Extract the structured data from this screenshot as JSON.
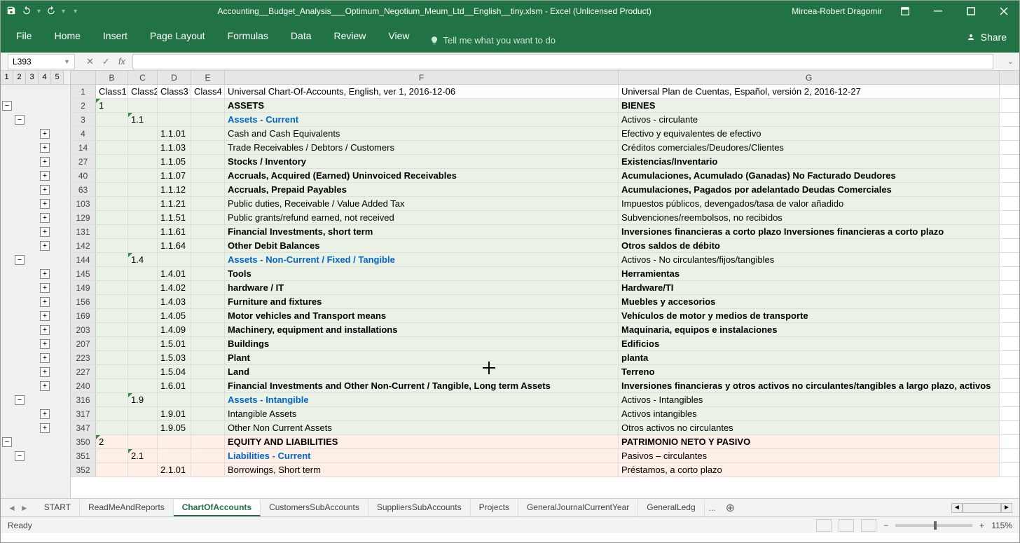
{
  "titlebar": {
    "title": "Accounting__Budget_Analysis___Optimum_Negotium_Meum_Ltd__English__tiny.xlsm  -  Excel (Unlicensed Product)",
    "username": "Mircea-Robert Dragomir"
  },
  "ribbon": {
    "tabs": [
      "File",
      "Home",
      "Insert",
      "Page Layout",
      "Formulas",
      "Data",
      "Review",
      "View"
    ],
    "tellme": "Tell me what you want to do",
    "share": "Share"
  },
  "namebox": "L393",
  "outline_levels": [
    "1",
    "2",
    "3",
    "4",
    "5"
  ],
  "columns": {
    "b": "B",
    "c": "C",
    "d": "D",
    "e": "E",
    "f": "F",
    "g": "G"
  },
  "header_row": {
    "num": "1",
    "b": "Class1",
    "c": "Class2",
    "d": "Class3",
    "e": "Class4",
    "f": "Universal Chart-Of-Accounts, English, ver 1, 2016-12-06",
    "g": "Universal Plan de Cuentas, Español, versión 2, 2016-12-27"
  },
  "rows": [
    {
      "num": "2",
      "b": "1",
      "c": "",
      "d": "",
      "e": "",
      "f": "ASSETS",
      "g": "BIENES",
      "bold": true,
      "bg": "green",
      "tri": "b"
    },
    {
      "num": "3",
      "b": "",
      "c": "1.1",
      "d": "",
      "e": "",
      "f": "Assets - Current",
      "g": "Activos - circulante",
      "blue": true,
      "bg": "green",
      "tri": "c"
    },
    {
      "num": "4",
      "b": "",
      "c": "",
      "d": "1.1.01",
      "e": "",
      "f": "Cash and Cash Equivalents",
      "g": "Efectivo y equivalentes de efectivo",
      "bg": "green"
    },
    {
      "num": "14",
      "b": "",
      "c": "",
      "d": "1.1.03",
      "e": "",
      "f": "Trade Receivables / Debtors / Customers",
      "g": "Créditos comerciales/Deudores/Clientes",
      "bg": "green"
    },
    {
      "num": "27",
      "b": "",
      "c": "",
      "d": "1.1.05",
      "e": "",
      "f": "Stocks / Inventory",
      "g": "Existencias/Inventario",
      "bold": true,
      "bg": "green"
    },
    {
      "num": "40",
      "b": "",
      "c": "",
      "d": "1.1.07",
      "e": "",
      "f": "Accruals, Acquired (Earned) Uninvoiced Receivables",
      "g": "Acumulaciones, Acumulado (Ganadas) No Facturado Deudores",
      "bold": true,
      "bg": "green"
    },
    {
      "num": "63",
      "b": "",
      "c": "",
      "d": "1.1.12",
      "e": "",
      "f": "Accruals, Prepaid Payables",
      "g": "Acumulaciones, Pagados por adelantado Deudas Comerciales",
      "bold": true,
      "bg": "green"
    },
    {
      "num": "103",
      "b": "",
      "c": "",
      "d": "1.1.21",
      "e": "",
      "f": "Public duties, Receivable / Value Added Tax",
      "g": "Impuestos públicos, devengados/tasa de valor añadido",
      "bg": "green"
    },
    {
      "num": "129",
      "b": "",
      "c": "",
      "d": "1.1.51",
      "e": "",
      "f": "Public grants/refund earned, not received",
      "g": "Subvenciones/reembolsos, no recibidos",
      "bg": "green"
    },
    {
      "num": "131",
      "b": "",
      "c": "",
      "d": "1.1.61",
      "e": "",
      "f": "Financial Investments, short term",
      "g": "Inversiones financieras a corto plazo Inversiones financieras a corto plazo",
      "bold": true,
      "bg": "green"
    },
    {
      "num": "142",
      "b": "",
      "c": "",
      "d": "1.1.64",
      "e": "",
      "f": "Other Debit Balances",
      "g": "Otros saldos de débito",
      "bold": true,
      "bg": "green"
    },
    {
      "num": "144",
      "b": "",
      "c": "1.4",
      "d": "",
      "e": "",
      "f": "Assets - Non-Current / Fixed / Tangible",
      "g": "Activos - No circulantes/fijos/tangibles",
      "blue": true,
      "bg": "green",
      "tri": "c"
    },
    {
      "num": "145",
      "b": "",
      "c": "",
      "d": "1.4.01",
      "e": "",
      "f": "Tools",
      "g": "Herramientas",
      "bold": true,
      "bg": "green"
    },
    {
      "num": "149",
      "b": "",
      "c": "",
      "d": "1.4.02",
      "e": "",
      "f": "hardware / IT",
      "g": "Hardware/TI",
      "bold": true,
      "bg": "green"
    },
    {
      "num": "156",
      "b": "",
      "c": "",
      "d": "1.4.03",
      "e": "",
      "f": "Furniture and fixtures",
      "g": "Muebles y accesorios",
      "bold": true,
      "bg": "green"
    },
    {
      "num": "169",
      "b": "",
      "c": "",
      "d": "1.4.05",
      "e": "",
      "f": "Motor vehicles and Transport means",
      "g": "Vehículos de motor y medios de transporte",
      "bold": true,
      "bg": "green"
    },
    {
      "num": "203",
      "b": "",
      "c": "",
      "d": "1.4.09",
      "e": "",
      "f": "Machinery, equipment and installations",
      "g": "Maquinaria, equipos e instalaciones",
      "bold": true,
      "bg": "green"
    },
    {
      "num": "207",
      "b": "",
      "c": "",
      "d": "1.5.01",
      "e": "",
      "f": "Buildings",
      "g": "Edificios",
      "bold": true,
      "bg": "green"
    },
    {
      "num": "223",
      "b": "",
      "c": "",
      "d": "1.5.03",
      "e": "",
      "f": "Plant",
      "g": "planta",
      "bold": true,
      "bg": "green"
    },
    {
      "num": "227",
      "b": "",
      "c": "",
      "d": "1.5.04",
      "e": "",
      "f": "Land",
      "g": "Terreno",
      "bold": true,
      "bg": "green"
    },
    {
      "num": "240",
      "b": "",
      "c": "",
      "d": "1.6.01",
      "e": "",
      "f": "Financial Investments and Other Non-Current / Tangible, Long term Assets",
      "g": "Inversiones financieras y otros activos no circulantes/tangibles a largo plazo, activos",
      "bold": true,
      "bg": "green"
    },
    {
      "num": "316",
      "b": "",
      "c": "1.9",
      "d": "",
      "e": "",
      "f": "Assets - Intangible",
      "g": "Activos - Intangibles",
      "blue": true,
      "bg": "green",
      "tri": "c"
    },
    {
      "num": "317",
      "b": "",
      "c": "",
      "d": "1.9.01",
      "e": "",
      "f": "Intangible Assets",
      "g": "Activos intangibles",
      "bg": "green"
    },
    {
      "num": "347",
      "b": "",
      "c": "",
      "d": "1.9.05",
      "e": "",
      "f": "Other Non Current Assets",
      "g": "Otros activos no circulantes",
      "bg": "green"
    },
    {
      "num": "350",
      "b": "2",
      "c": "",
      "d": "",
      "e": "",
      "f": "EQUITY AND LIABILITIES",
      "g": "PATRIMONIO NETO Y PASIVO",
      "bold": true,
      "bg": "pink",
      "tri": "b"
    },
    {
      "num": "351",
      "b": "",
      "c": "2.1",
      "d": "",
      "e": "",
      "f": "Liabilities - Current",
      "g": "Pasivos – circulantes",
      "blue": true,
      "bg": "pink",
      "tri": "c"
    },
    {
      "num": "352",
      "b": "",
      "c": "",
      "d": "2.1.01",
      "e": "",
      "f": "Borrowings, Short term",
      "g": "Préstamos, a corto plazo",
      "bg": "pink"
    }
  ],
  "outline_buttons": [
    {
      "row": 0,
      "col": 0,
      "type": "minus"
    },
    {
      "row": 1,
      "col": 1,
      "type": "minus"
    },
    {
      "row": 2,
      "col": 3,
      "type": "plus"
    },
    {
      "row": 3,
      "col": 3,
      "type": "plus"
    },
    {
      "row": 4,
      "col": 3,
      "type": "plus"
    },
    {
      "row": 5,
      "col": 3,
      "type": "plus"
    },
    {
      "row": 6,
      "col": 3,
      "type": "plus"
    },
    {
      "row": 7,
      "col": 3,
      "type": "plus"
    },
    {
      "row": 8,
      "col": 3,
      "type": "plus"
    },
    {
      "row": 9,
      "col": 3,
      "type": "plus"
    },
    {
      "row": 10,
      "col": 3,
      "type": "plus"
    },
    {
      "row": 11,
      "col": 1,
      "type": "minus"
    },
    {
      "row": 12,
      "col": 3,
      "type": "plus"
    },
    {
      "row": 13,
      "col": 3,
      "type": "plus"
    },
    {
      "row": 14,
      "col": 3,
      "type": "plus"
    },
    {
      "row": 15,
      "col": 3,
      "type": "plus"
    },
    {
      "row": 16,
      "col": 3,
      "type": "plus"
    },
    {
      "row": 17,
      "col": 3,
      "type": "plus"
    },
    {
      "row": 18,
      "col": 3,
      "type": "plus"
    },
    {
      "row": 19,
      "col": 3,
      "type": "plus"
    },
    {
      "row": 20,
      "col": 3,
      "type": "plus"
    },
    {
      "row": 21,
      "col": 1,
      "type": "minus"
    },
    {
      "row": 22,
      "col": 3,
      "type": "plus"
    },
    {
      "row": 23,
      "col": 3,
      "type": "plus"
    },
    {
      "row": 24,
      "col": 0,
      "type": "minus"
    },
    {
      "row": 25,
      "col": 1,
      "type": "minus"
    }
  ],
  "sheettabs": {
    "tabs": [
      "START",
      "ReadMeAndReports",
      "ChartOfAccounts",
      "CustomersSubAccounts",
      "SuppliersSubAccounts",
      "Projects",
      "GeneralJournalCurrentYear",
      "GeneralLedg"
    ],
    "active": 2,
    "more": "..."
  },
  "status": {
    "ready": "Ready",
    "zoom": "115%"
  }
}
